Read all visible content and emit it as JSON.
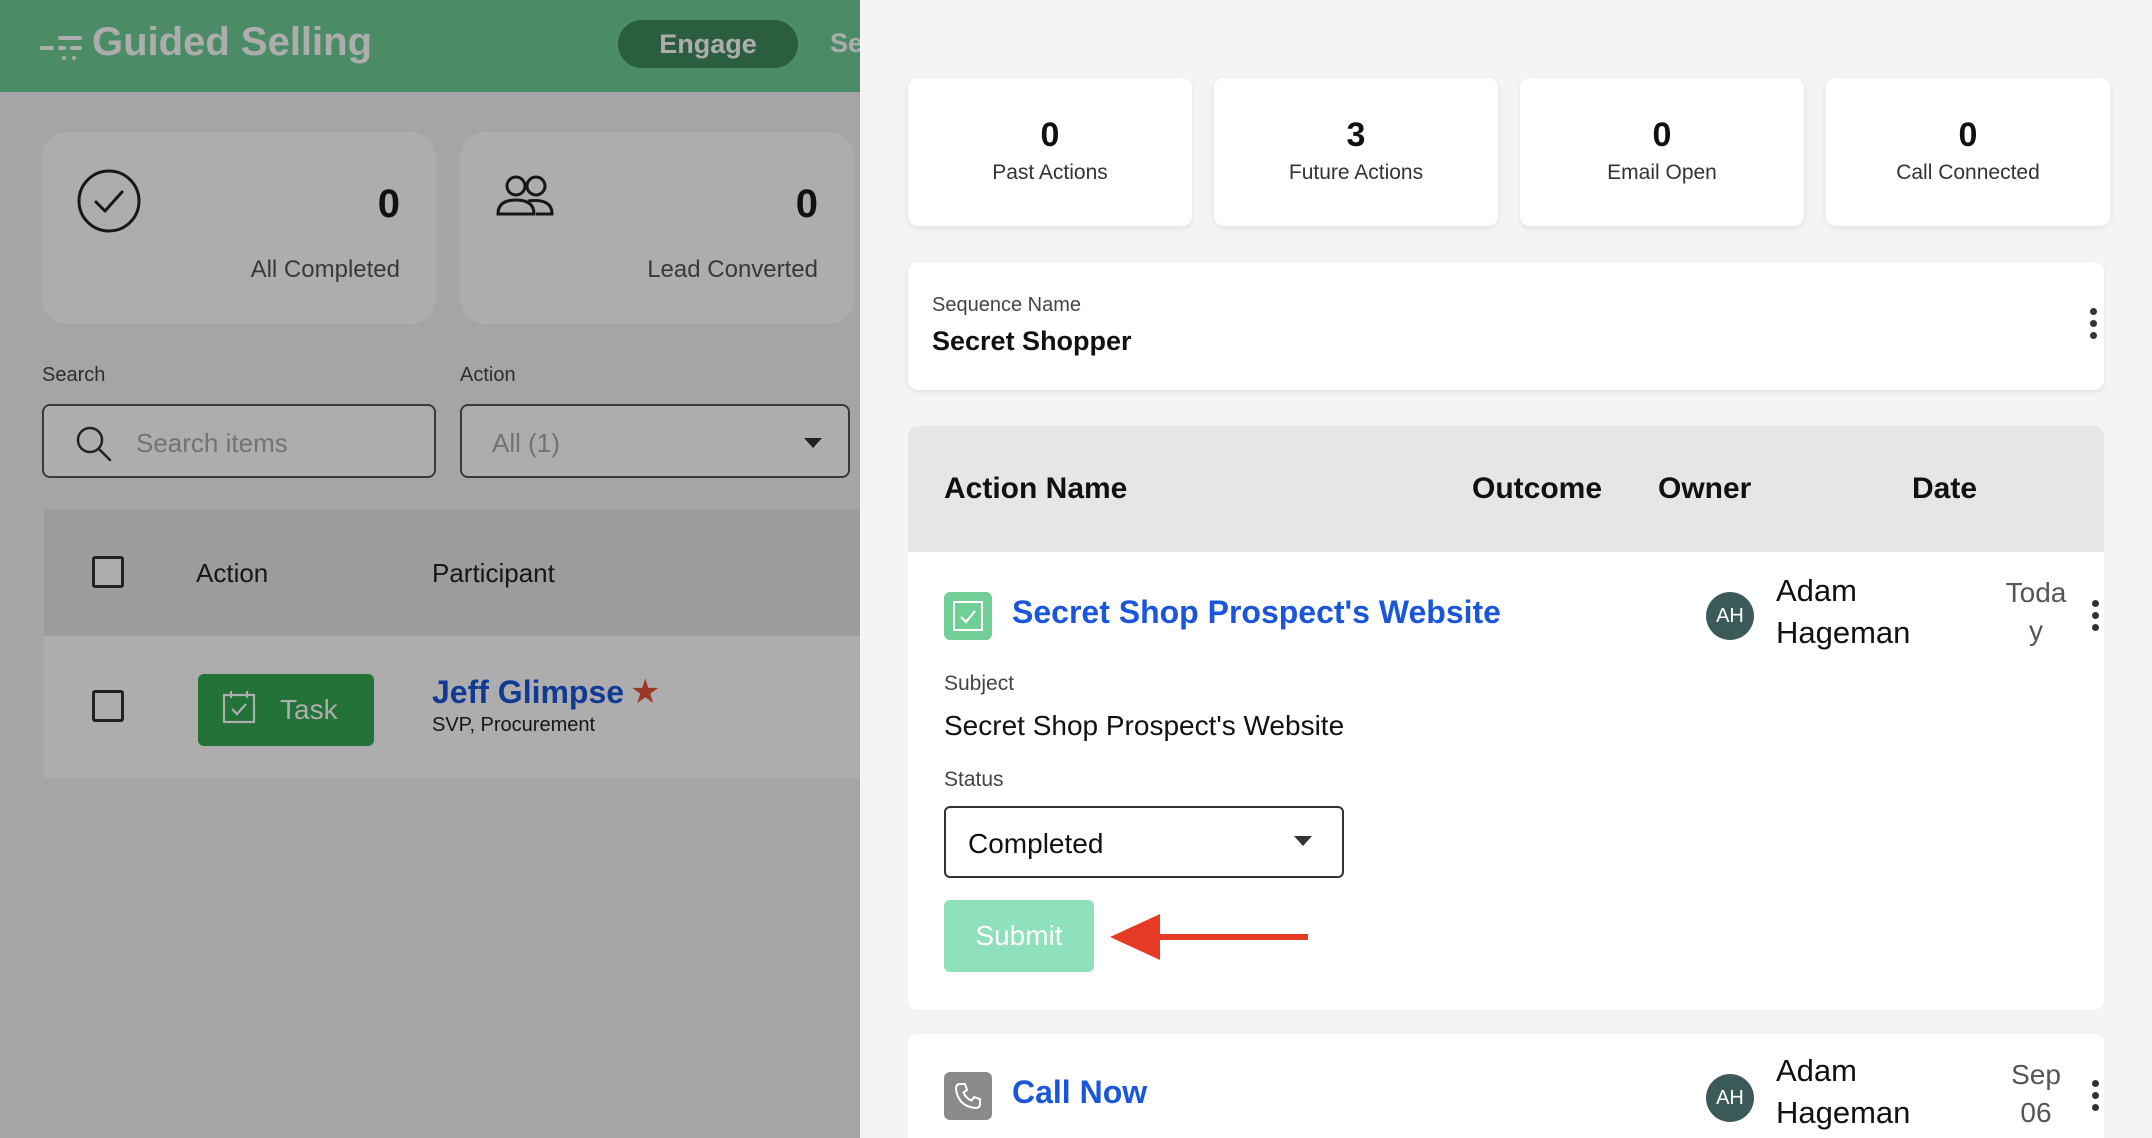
{
  "app": {
    "title": "Guided Selling",
    "nav": {
      "active": "Engage",
      "next_partial": "Se"
    }
  },
  "left_stats": [
    {
      "icon": "check-circle-icon",
      "value": "0",
      "label": "All Completed"
    },
    {
      "icon": "users-icon",
      "value": "0",
      "label": "Lead Converted"
    }
  ],
  "filters": {
    "search_label": "Search",
    "search_placeholder": "Search items",
    "action_label": "Action",
    "action_value": "All (1)"
  },
  "list": {
    "columns": [
      "Action",
      "Participant"
    ],
    "rows": [
      {
        "action": "Task",
        "participant_name": "Jeff Glimpse",
        "participant_title": "SVP, Procurement"
      }
    ]
  },
  "panel": {
    "stats": [
      {
        "value": "0",
        "label": "Past Actions"
      },
      {
        "value": "3",
        "label": "Future Actions"
      },
      {
        "value": "0",
        "label": "Email Open"
      },
      {
        "value": "0",
        "label": "Call Connected"
      }
    ],
    "sequence": {
      "label": "Sequence Name",
      "value": "Secret Shopper"
    },
    "columns": {
      "action_name": "Action Name",
      "outcome": "Outcome",
      "owner": "Owner",
      "date": "Date"
    },
    "actions": [
      {
        "type_icon": "task-icon",
        "title": "Secret Shop Prospect's Website",
        "owner_initials": "AH",
        "owner_first": "Adam",
        "owner_last": "Hageman",
        "date_line1": "Toda",
        "date_line2": "y",
        "subject_label": "Subject",
        "subject_value": "Secret Shop Prospect's Website",
        "status_label": "Status",
        "status_value": "Completed",
        "submit_label": "Submit"
      },
      {
        "type_icon": "phone-icon",
        "title": "Call Now",
        "owner_initials": "AH",
        "owner_first": "Adam",
        "owner_last": "Hageman",
        "date_line1": "Sep",
        "date_line2": "06"
      }
    ]
  },
  "colors": {
    "brand_green": "#6fcf97",
    "link_blue": "#1a56db",
    "task_green": "#34a853",
    "submit_disabled": "#8fe0bd",
    "annotation_arrow": "#e53a25"
  }
}
